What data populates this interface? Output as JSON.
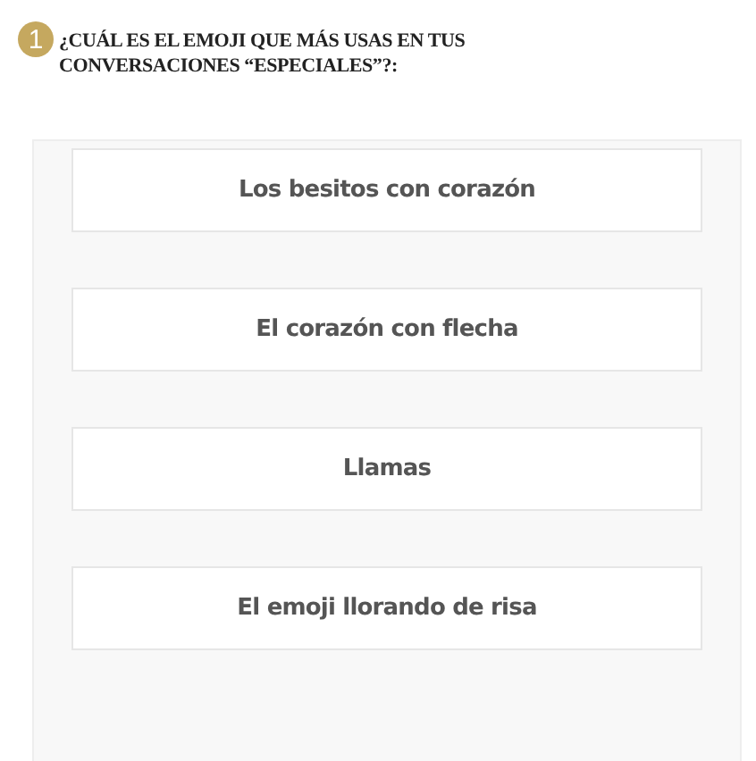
{
  "question": {
    "number": "1",
    "text": "¿CUÁL ES EL EMOJI QUE MÁS USAS EN TUS CONVERSACIONES “ESPECIALES”?:"
  },
  "answers": [
    {
      "label": "Los besitos con corazón"
    },
    {
      "label": "El corazón con flecha"
    },
    {
      "label": "Llamas"
    },
    {
      "label": "El emoji llorando de risa"
    }
  ]
}
